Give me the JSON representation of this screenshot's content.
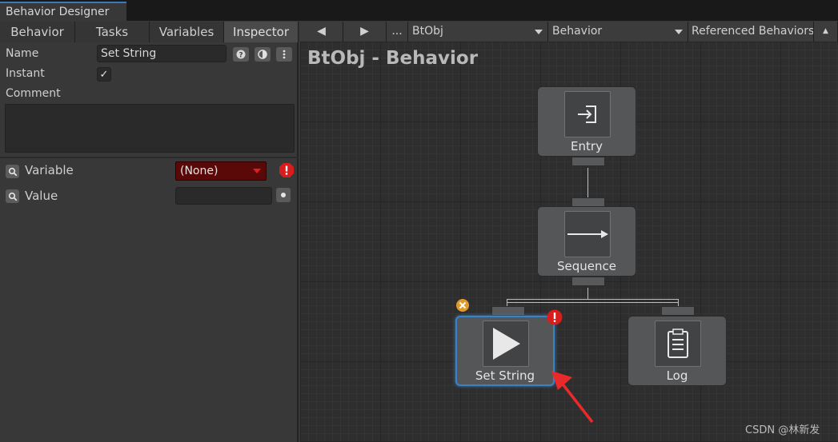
{
  "window": {
    "title": "Behavior Designer"
  },
  "inspector_tabs": [
    {
      "label": "Behavior"
    },
    {
      "label": "Tasks"
    },
    {
      "label": "Variables"
    },
    {
      "label": "Inspector",
      "active": true
    }
  ],
  "inspector": {
    "name_label": "Name",
    "name_value": "Set String",
    "instant_label": "Instant",
    "instant_checked": true,
    "instant_mark": "✓",
    "comment_label": "Comment",
    "comment_value": "",
    "variable_label": "Variable",
    "variable_value": "(None)",
    "value_label": "Value",
    "value_value": ""
  },
  "toolbar": {
    "prev": "◀",
    "next": "▶",
    "more": "...",
    "object_select": "BtObj",
    "behavior_select": "Behavior",
    "referenced_select": "Referenced Behaviors",
    "overflow": "▲"
  },
  "graph": {
    "title": "BtObj - Behavior",
    "nodes": [
      {
        "label": "Entry",
        "icon": "entry-icon"
      },
      {
        "label": "Sequence",
        "icon": "arrow-right-icon"
      },
      {
        "label": "Set String",
        "icon": "play-icon",
        "selected": true,
        "has_error": true
      },
      {
        "label": "Log",
        "icon": "clipboard-icon"
      }
    ]
  },
  "watermark": "CSDN @林新发",
  "colors": {
    "accent": "#3b82c4",
    "error": "#e02020",
    "annotation_arrow": "#ea2a2a"
  }
}
